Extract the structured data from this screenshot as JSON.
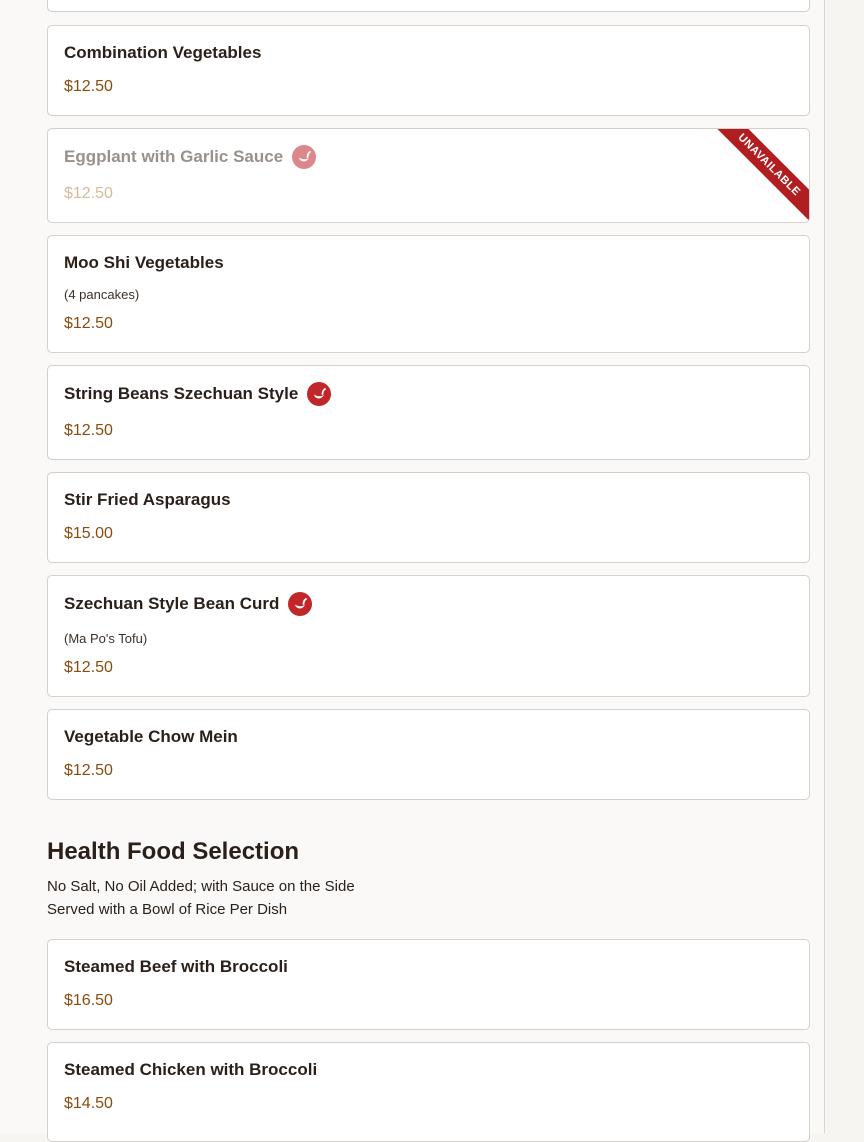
{
  "menu": {
    "items": [
      {
        "name": "Combination Vegetables",
        "price": "$12.50"
      },
      {
        "name": "Eggplant with Garlic Sauce",
        "price": "$12.50",
        "spicy": true,
        "badge": "UNAVAILABLE"
      },
      {
        "name": "Moo Shi Vegetables",
        "description": "(4 pancakes)",
        "price": "$12.50"
      },
      {
        "name": "String Beans Szechuan Style",
        "price": "$12.50",
        "spicy": true
      },
      {
        "name": "Stir Fried Asparagus",
        "price": "$15.00"
      },
      {
        "name": "Szechuan Style Bean Curd",
        "description": "(Ma Po's Tofu)",
        "price": "$12.50",
        "spicy": true
      },
      {
        "name": "Vegetable Chow Mein",
        "price": "$12.50"
      }
    ]
  },
  "health_section": {
    "title": "Health Food Selection",
    "note_line1": "No Salt, No Oil Added; with Sauce on the Side",
    "note_line2": "Served with a Bowl of Rice Per Dish",
    "items": [
      {
        "name": "Steamed Beef with Broccoli",
        "price": "$16.50"
      },
      {
        "name": "Steamed Chicken with Broccoli",
        "price": "$14.50"
      }
    ]
  },
  "icons": {
    "spicy": "spicy-pepper-icon"
  },
  "colors": {
    "price": "#8a4b0f",
    "spicy_badge": "#c0262a",
    "unavailable_ribbon": "#b11e22"
  }
}
